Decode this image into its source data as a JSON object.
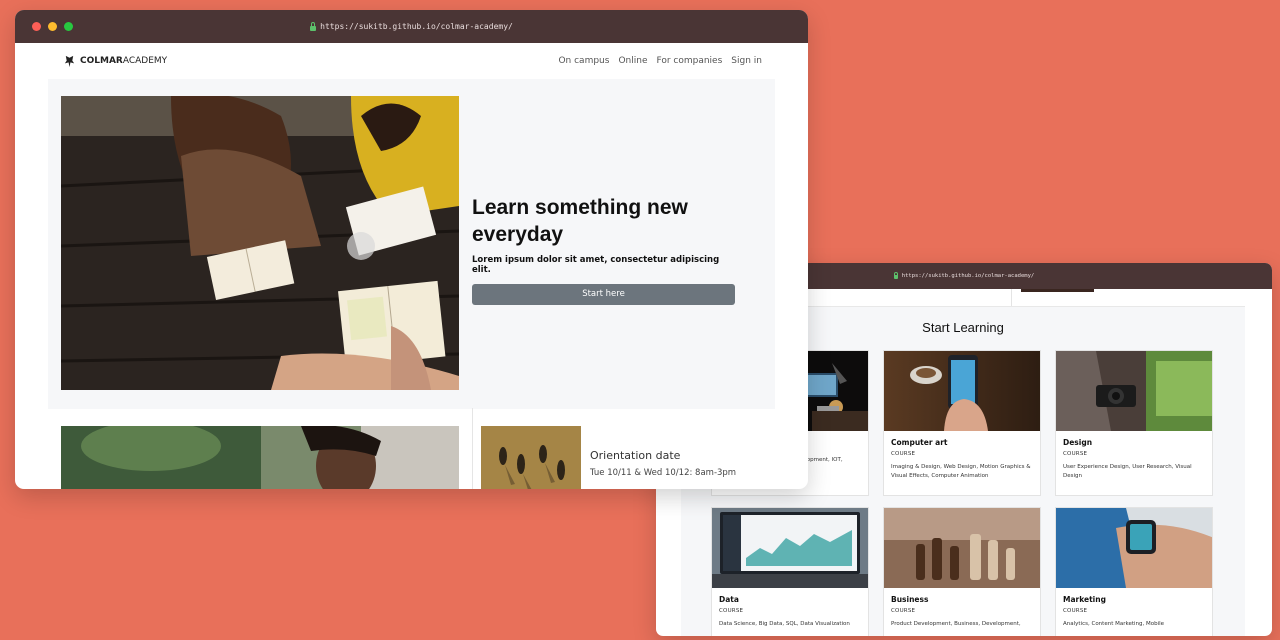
{
  "window1": {
    "url": "https://sukitb.github.io/colmar-academy/",
    "brand": {
      "bold": "COLMAR",
      "light": "ACADEMY"
    },
    "nav": [
      "On campus",
      "Online",
      "For companies",
      "Sign in"
    ],
    "hero": {
      "title": "Learn something new everyday",
      "subtitle": "Lorem ipsum dolor sit amet, consectetur adipiscing elit.",
      "button": "Start here"
    },
    "orientation": {
      "title": "Orientation date",
      "date": "Tue 10/11 & Wed 10/12: 8am-3pm"
    }
  },
  "window2": {
    "url": "https://sukitb.github.io/colmar-academy/",
    "section_title": "Start Learning",
    "cards": [
      {
        "title": "",
        "kind": "",
        "desc": "Development, IOT,"
      },
      {
        "title": "Computer art",
        "kind": "COURSE",
        "desc": "Imaging & Design, Web Design, Motion Graphics & Visual Effects, Computer Animation"
      },
      {
        "title": "Design",
        "kind": "COURSE",
        "desc": "User Experience Design, User Research, Visual Design"
      },
      {
        "title": "Data",
        "kind": "COURSE",
        "desc": "Data Science, Big Data, SQL, Data Visualization"
      },
      {
        "title": "Business",
        "kind": "COURSE",
        "desc": "Product Development, Business, Development,"
      },
      {
        "title": "Marketing",
        "kind": "COURSE",
        "desc": "Analytics, Content Marketing, Mobile"
      }
    ]
  },
  "colors": {
    "background": "#e8705a",
    "titlebar": "#4a3535",
    "hero_button": "#6c757d",
    "panel": "#f6f7f9"
  }
}
